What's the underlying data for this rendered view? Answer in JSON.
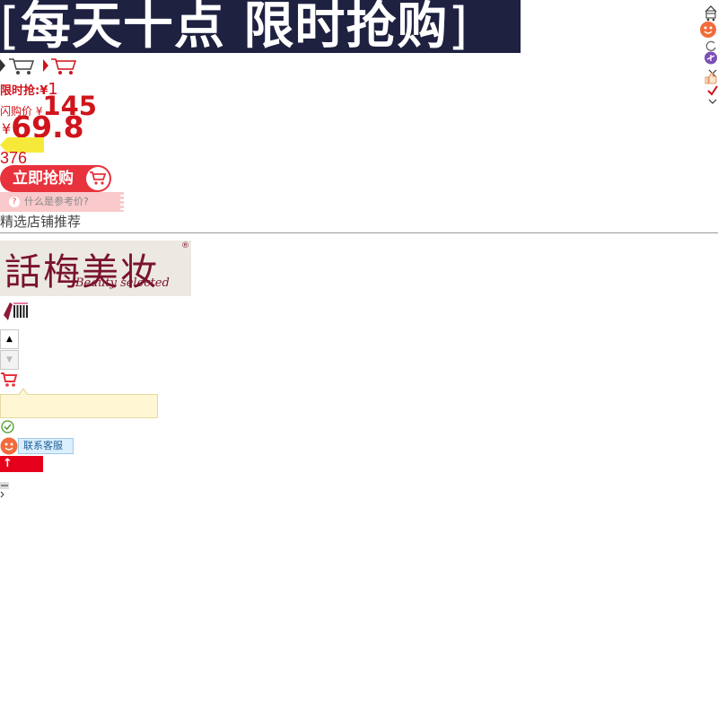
{
  "banner": {
    "bracket_left": "[",
    "title": "每天十点 限时抢购",
    "bracket_right": "]"
  },
  "product": {
    "limited_label": "限时抢:¥",
    "limited_value": "1",
    "flash_label": "闪购价 ¥",
    "flash_value": "145",
    "currency": "¥",
    "price": "69.8",
    "sold_count": "376",
    "buy_button": "立即抢购",
    "reference_price_question": "?",
    "reference_price_label": "什么是参考价?"
  },
  "shop": {
    "recommend_title": "精选店铺推荐",
    "logo_cn": "話梅美妆",
    "logo_en": "Beauty selected",
    "logo_reg": "®"
  },
  "widgets": {
    "stepper_up": "▲",
    "stepper_down": "▼",
    "customer_service": "联系客服",
    "back_to_top": "↑"
  },
  "icons": {
    "right_sidebar": [
      "chevron-up-icon",
      "cart-icon",
      "service-face-icon",
      "refresh-icon",
      "plane-icon",
      "close-icon",
      "thumb-up-icon",
      "check-icon",
      "chevron-down-icon"
    ],
    "row": [
      "chevron-right-icon",
      "cart-outline-icon",
      "chevron-right-icon",
      "cart-red-icon"
    ]
  },
  "colors": {
    "banner_bg": "#1e2140",
    "accent_red": "#d0141b",
    "buy_button": "#e8323c",
    "reference_bg": "#f9c9cc",
    "logo_text": "#7a1330",
    "top_button": "#e5001b"
  }
}
